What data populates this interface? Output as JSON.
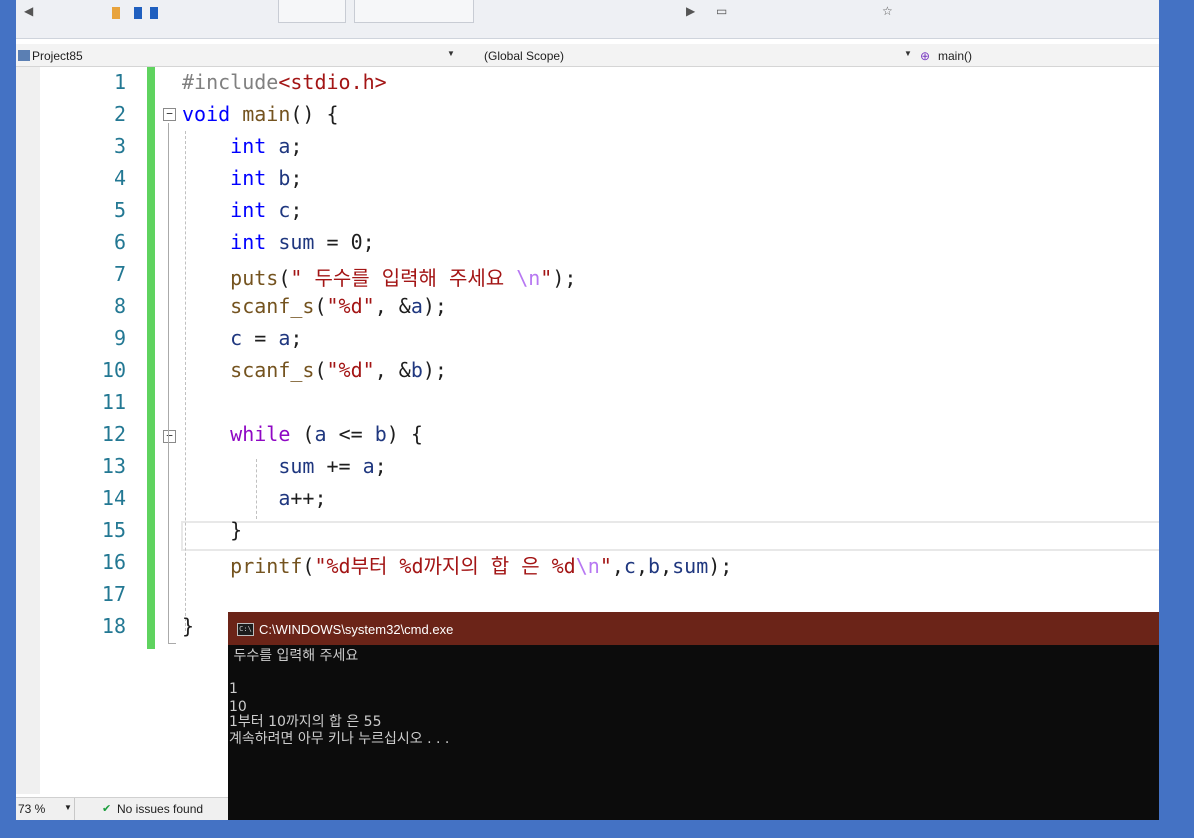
{
  "navbar": {
    "project": "Project85",
    "scope": "(Global Scope)",
    "member": "main()"
  },
  "editor": {
    "lines": [
      {
        "num": "1"
      },
      {
        "num": "2"
      },
      {
        "num": "3"
      },
      {
        "num": "4"
      },
      {
        "num": "5"
      },
      {
        "num": "6"
      },
      {
        "num": "7"
      },
      {
        "num": "8"
      },
      {
        "num": "9"
      },
      {
        "num": "10"
      },
      {
        "num": "11"
      },
      {
        "num": "12"
      },
      {
        "num": "13"
      },
      {
        "num": "14"
      },
      {
        "num": "15"
      },
      {
        "num": "16"
      },
      {
        "num": "17"
      },
      {
        "num": "18"
      }
    ],
    "tokens": {
      "include": "#include",
      "header": "<stdio.h>",
      "void": "void",
      "main": "main",
      "main_rest": "() {",
      "int": "int",
      "a": "a",
      "b": "b",
      "c": "c",
      "sum": "sum",
      "semi": ";",
      "sum_init": " = 0;",
      "puts": "puts",
      "puts_str": "\" 두수를 입력해 주세요 ",
      "nl": "\\n",
      "quote_close": "\"",
      "puts_end": ");",
      "scanf": "scanf_s",
      "open": "(",
      "fmt_d": "\"%d\"",
      "amp_a": ", &",
      "close": ");",
      "eq": " = ",
      "while": "while",
      "cond_open": " (",
      "le": " <= ",
      "cond_close": ") {",
      "plus_eq": " += ",
      "incr": "++;",
      "brace_close": "}",
      "printf": "printf",
      "pf_fmt": "\"%d부터 %d까지의 합 은 %d",
      "pf_args": ",",
      "pf_end": ");"
    }
  },
  "status": {
    "zoom": "73 %",
    "issues": "No issues found"
  },
  "console": {
    "title": "C:\\WINDOWS\\system32\\cmd.exe",
    "output": [
      " 두수를 입력해 주세요",
      "",
      "1",
      "10",
      "1부터 10까지의 합 은 55",
      "계속하려면 아무 키나 누르십시오 . . ."
    ]
  }
}
